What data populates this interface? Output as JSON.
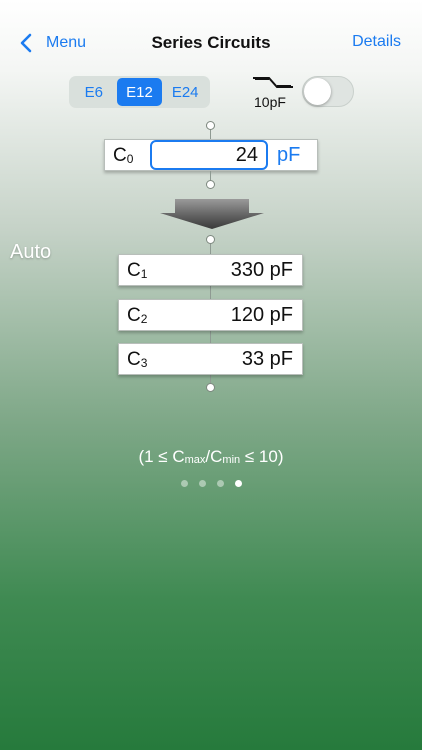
{
  "nav": {
    "back_label": "Menu",
    "title": "Series Circuits",
    "details_label": "Details"
  },
  "series": {
    "options": [
      "E6",
      "E12",
      "E24"
    ],
    "selected": "E12"
  },
  "stray": {
    "label": "10pF",
    "enabled": false
  },
  "c0": {
    "label": "C",
    "subscript": "0",
    "value": "24",
    "unit": "pF"
  },
  "mode": "Auto",
  "results": [
    {
      "label": "C",
      "subscript": "1",
      "value": "330 pF"
    },
    {
      "label": "C",
      "subscript": "2",
      "value": "120 pF"
    },
    {
      "label": "C",
      "subscript": "3",
      "value": "33 pF"
    }
  ],
  "constraint": {
    "prefix": "(1 ≤ C",
    "max_sub": "max",
    "slash": "/C",
    "min_sub": "min",
    "suffix": " ≤ 10)"
  },
  "pager": {
    "count": 4,
    "active": 4
  },
  "colors": {
    "accent": "#1b7bf0",
    "background_bottom": "#267a3c"
  },
  "icons": {
    "back": "chevron-left-icon",
    "capacitor": "capacitor-icon",
    "convert": "arrow-down-icon"
  }
}
